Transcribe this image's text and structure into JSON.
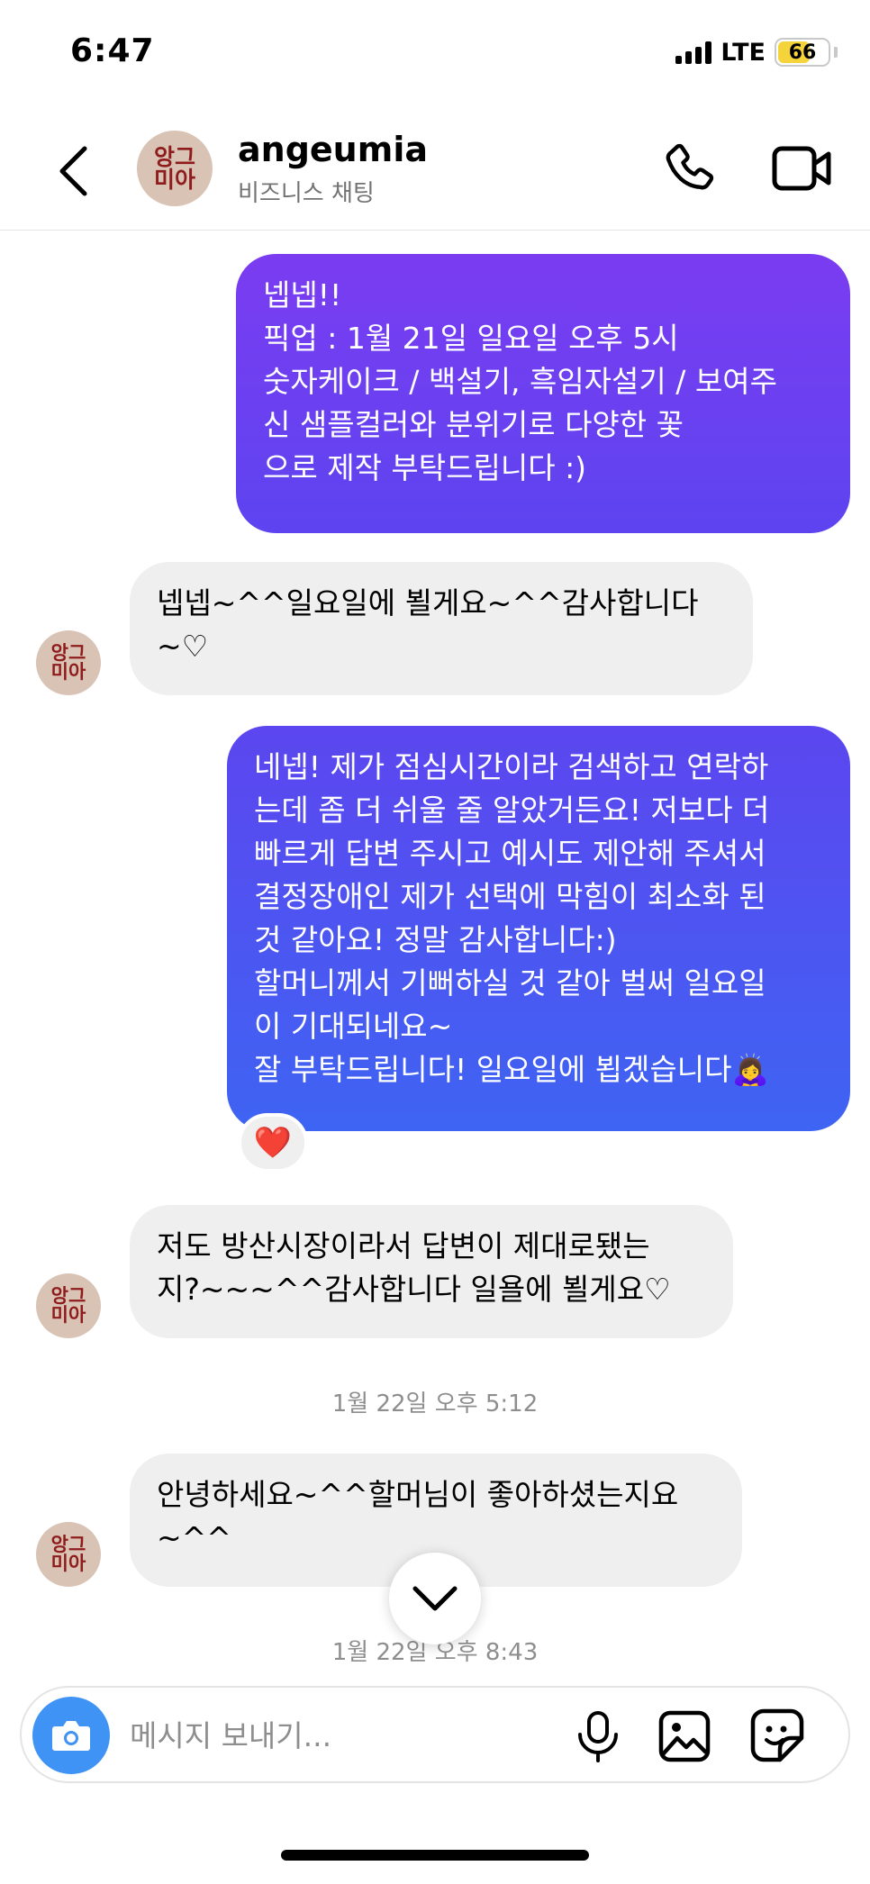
{
  "status_bar": {
    "time": "6:47",
    "network": "LTE",
    "battery": "66"
  },
  "header": {
    "avatar_text_line1": "앙그",
    "avatar_text_line2": "미아",
    "title": "angeumia",
    "subtitle": "비즈니스 채팅",
    "icons": [
      "back-arrow-icon",
      "phone-icon",
      "video-camera-icon"
    ]
  },
  "messages": [
    {
      "side": "outgoing",
      "text": "넵넵!!\n픽업 : 1월 21일 일요일 오후 5시\n숫자케이크 / 백설기, 흑임자설기 / 보여주\n신 샘플컬러와 분위기로 다양한 꽃\n으로 제작 부탁드립니다 :)"
    },
    {
      "side": "incoming",
      "text": "넵넵~^^일요일에  뵐게요~^^감사합니다\n~♡"
    },
    {
      "side": "outgoing",
      "text": "네넵! 제가 점심시간이라 검색하고 연락하\n는데 좀 더 쉬울 줄 알았거든요! 저보다 더\n빠르게 답변 주시고 예시도 제안해 주셔서\n결정장애인 제가 선택에 막힘이 최소화 된\n것 같아요! 정말 감사합니다:)\n할머니께서 기뻐하실 것 같아 벌써 일요일\n이 기대되네요~\n잘 부탁드립니다! 일요일에 뵙겠습니다🙇‍♀️",
      "reaction": "❤️"
    },
    {
      "side": "incoming",
      "text": "저도 방산시장이라서 답변이 제대로됐는\n지?~~~^^감사합니다  일욜에 뵐게요♡"
    },
    {
      "side": "incoming",
      "text": "안녕하세요~^^할머님이 좋아하셨는지요\n~^^"
    }
  ],
  "timestamps": [
    "1월 22일 오후 5:12",
    "1월 22일 오후 8:43"
  ],
  "composer": {
    "placeholder": "메시지 보내기...",
    "icons": [
      "camera-icon",
      "microphone-icon",
      "gallery-icon",
      "sticker-icon"
    ]
  },
  "colors": {
    "outgoing_gradient_top": "#7b3cf1",
    "outgoing_gradient_bottom": "#3e64f3",
    "incoming_bubble": "#efefef",
    "camera_button": "#3f93f5",
    "avatar_logo": "#8e1c1c",
    "avatar_bg": "#d9c3b5"
  }
}
